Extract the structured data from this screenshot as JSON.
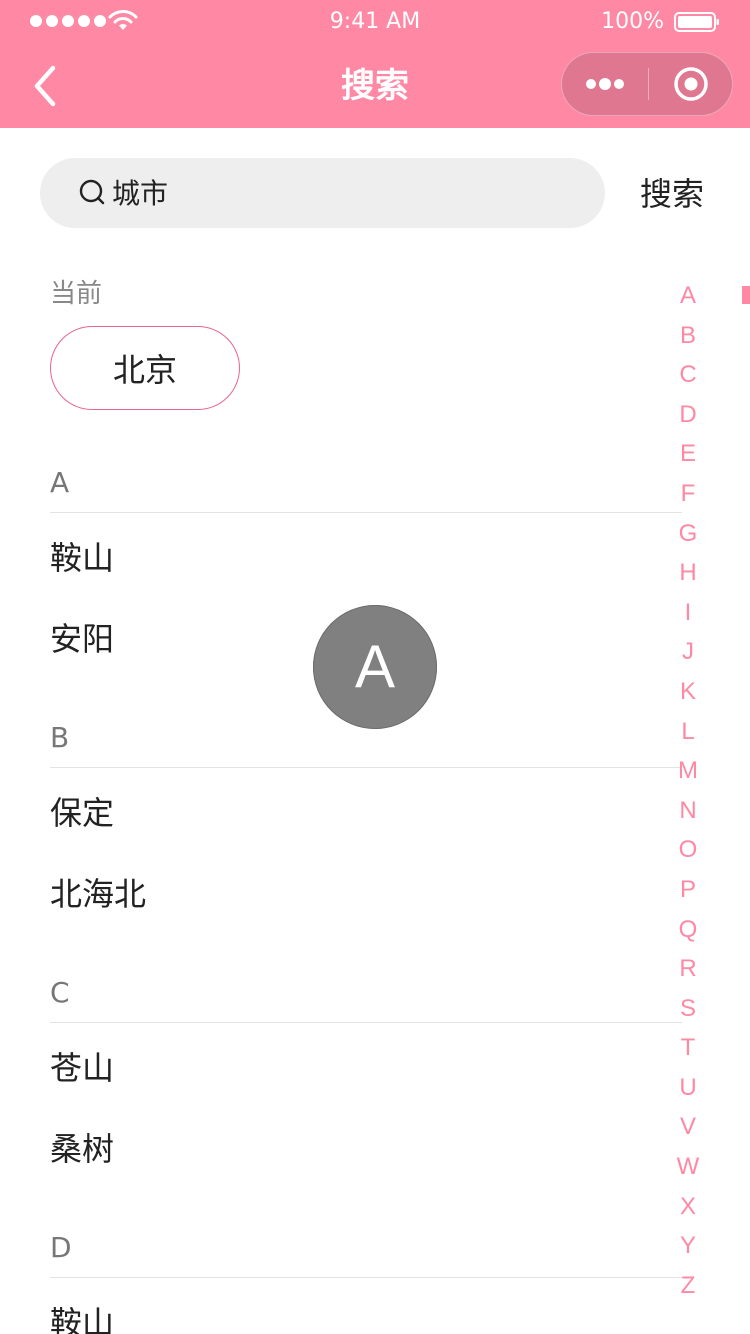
{
  "status_bar": {
    "time": "9:41 AM",
    "battery": "100%"
  },
  "nav": {
    "title": "搜索"
  },
  "search": {
    "placeholder": "城市",
    "button_label": "搜索"
  },
  "current": {
    "label": "当前",
    "city": "北京"
  },
  "sections": [
    {
      "letter": "A",
      "cities": [
        "鞍山",
        "安阳"
      ]
    },
    {
      "letter": "B",
      "cities": [
        "保定",
        "北海北"
      ]
    },
    {
      "letter": "C",
      "cities": [
        "苍山",
        "桑树"
      ]
    },
    {
      "letter": "D",
      "cities": [
        "鞍山"
      ]
    }
  ],
  "index_letters": [
    "A",
    "B",
    "C",
    "D",
    "E",
    "F",
    "G",
    "H",
    "I",
    "J",
    "K",
    "L",
    "M",
    "N",
    "O",
    "P",
    "Q",
    "R",
    "S",
    "T",
    "U",
    "V",
    "W",
    "X",
    "Y",
    "Z"
  ],
  "toast_letter": "A",
  "colors": {
    "accent": "#ff88a4",
    "border_accent": "#e8648c",
    "toast": "#808080"
  }
}
